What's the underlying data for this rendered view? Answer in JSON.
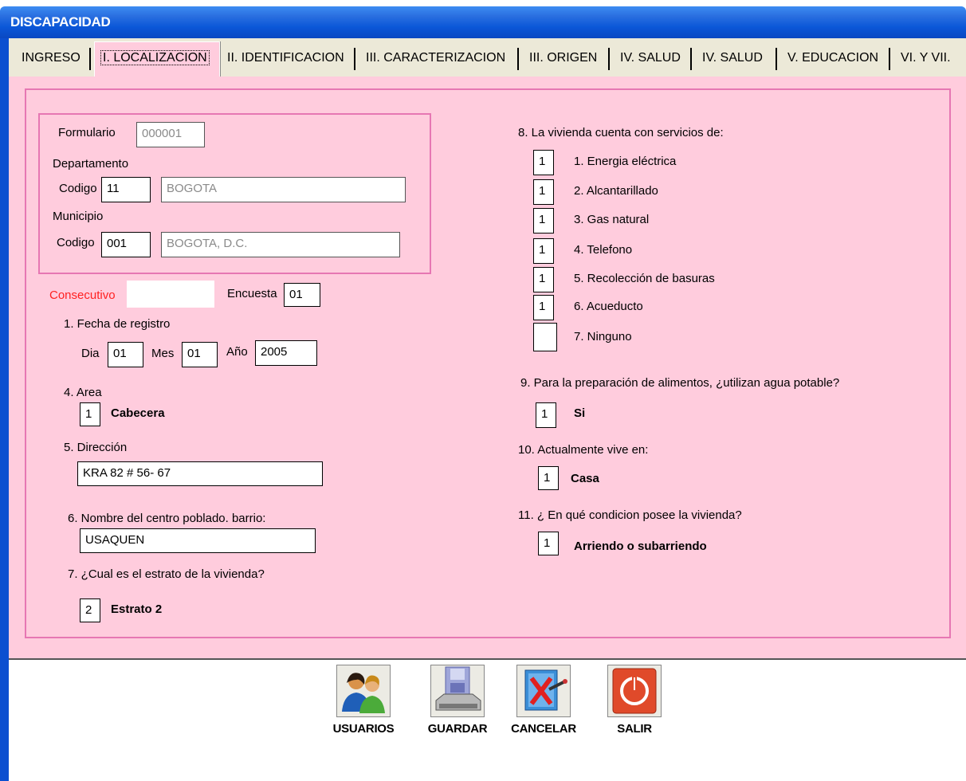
{
  "window": {
    "title": "DISCAPACIDAD"
  },
  "tabs": [
    {
      "label": "INGRESO"
    },
    {
      "label": "I. LOCALIZACION"
    },
    {
      "label": "II. IDENTIFICACION"
    },
    {
      "label": "III. CARACTERIZACION"
    },
    {
      "label": "III. ORIGEN"
    },
    {
      "label": "IV. SALUD"
    },
    {
      "label": "IV. SALUD"
    },
    {
      "label": "V. EDUCACION"
    },
    {
      "label": "VI. Y VII."
    }
  ],
  "form": {
    "formulario_label": "Formulario",
    "formulario_value": "000001",
    "departamento_label": "Departamento",
    "dep_codigo_label": "Codigo",
    "dep_codigo_value": "11",
    "dep_nombre_value": "BOGOTA",
    "municipio_label": "Municipio",
    "mun_codigo_label": "Codigo",
    "mun_codigo_value": "001",
    "mun_nombre_value": "BOGOTA, D.C.",
    "consecutivo_label": "Consecutivo",
    "consecutivo_value": "",
    "encuesta_label": "Encuesta",
    "encuesta_value": "01",
    "fecha_label": "1. Fecha de registro",
    "dia_label": "Dia",
    "dia_value": "01",
    "mes_label": "Mes",
    "mes_value": "01",
    "anio_label": "Año",
    "anio_value": "2005",
    "area_label": "4. Area",
    "area_code": "1",
    "area_text": "Cabecera",
    "direccion_label": "5. Dirección",
    "direccion_value": "KRA 82 # 56- 67",
    "barrio_label": "6. Nombre del centro poblado. barrio:",
    "barrio_value": "USAQUEN",
    "estrato_label": "7. ¿Cual es el estrato de la vivienda?",
    "estrato_code": "2",
    "estrato_text": "Estrato 2"
  },
  "servicios": {
    "label": "8. La vivienda cuenta con servicios de:",
    "items": [
      {
        "value": "1",
        "label": "1. Energia eléctrica"
      },
      {
        "value": "1",
        "label": "2. Alcantarillado"
      },
      {
        "value": "1",
        "label": "3. Gas natural"
      },
      {
        "value": "1",
        "label": "4. Telefono"
      },
      {
        "value": "1",
        "label": "5. Recolección de basuras"
      },
      {
        "value": "1",
        "label": "6. Acueducto"
      },
      {
        "value": "",
        "label": "7. Ninguno"
      }
    ]
  },
  "agua": {
    "label": "9. Para la preparación de alimentos, ¿utilizan agua potable?",
    "code": "1",
    "text": "Si"
  },
  "vive": {
    "label": "10. Actualmente vive en:",
    "code": "1",
    "text": "Casa"
  },
  "condicion": {
    "label": "11. ¿ En qué condicion posee la vivienda?",
    "code": "1",
    "text": "Arriendo o subarriendo"
  },
  "buttons": {
    "usuarios": "USUARIOS",
    "guardar": "GUARDAR",
    "cancelar": "CANCELAR",
    "salir": "SALIR"
  }
}
